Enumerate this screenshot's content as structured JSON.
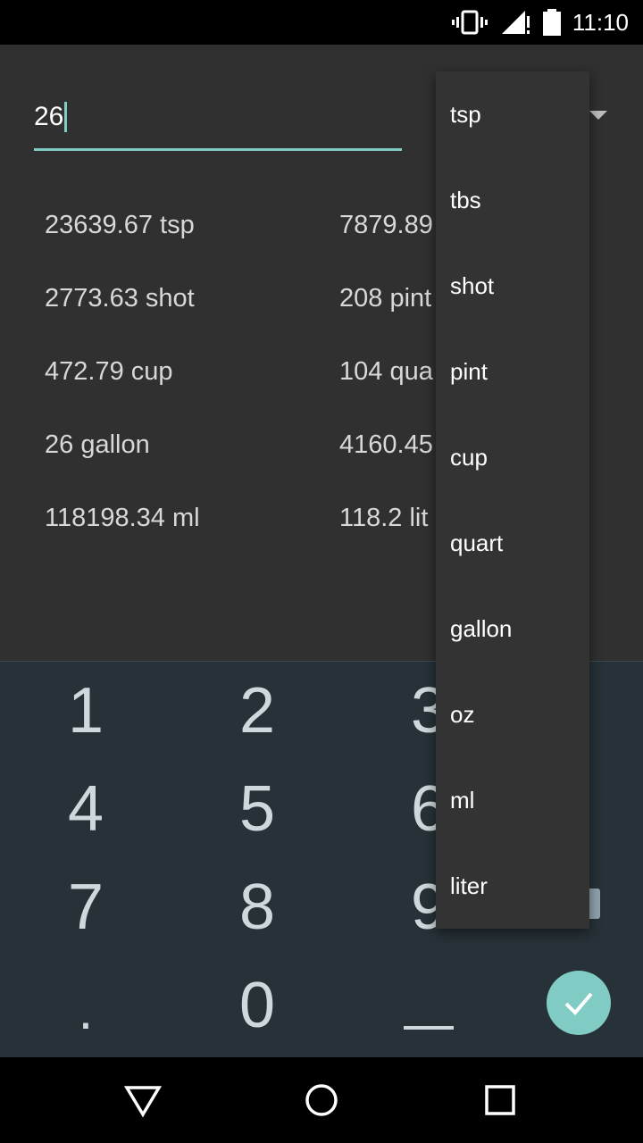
{
  "status_bar": {
    "time": "11:10",
    "icons": [
      "vibrate-icon",
      "signal-icon",
      "battery-icon"
    ]
  },
  "input": {
    "value": "26"
  },
  "results": [
    "23639.67 tsp",
    "7879.89",
    "2773.63 shot",
    "208 pint",
    "472.79 cup",
    "104 qua",
    "26 gallon",
    "4160.45",
    "118198.34 ml",
    "118.2 lit"
  ],
  "dropdown": {
    "selected": "tsp",
    "options": [
      "tsp",
      "tbs",
      "shot",
      "pint",
      "cup",
      "quart",
      "gallon",
      "oz",
      "ml",
      "liter"
    ]
  },
  "keypad": {
    "keys": [
      "1",
      "2",
      "3",
      "4",
      "5",
      "6",
      "7",
      "8",
      "9",
      ".",
      "0"
    ],
    "done_icon": "check-icon",
    "accent": "#80cbc4"
  },
  "nav": {
    "icons": [
      "back-icon",
      "home-icon",
      "recents-icon"
    ]
  },
  "colors": {
    "background": "#303030",
    "keypad": "#263238",
    "accent": "#80cbc4"
  }
}
